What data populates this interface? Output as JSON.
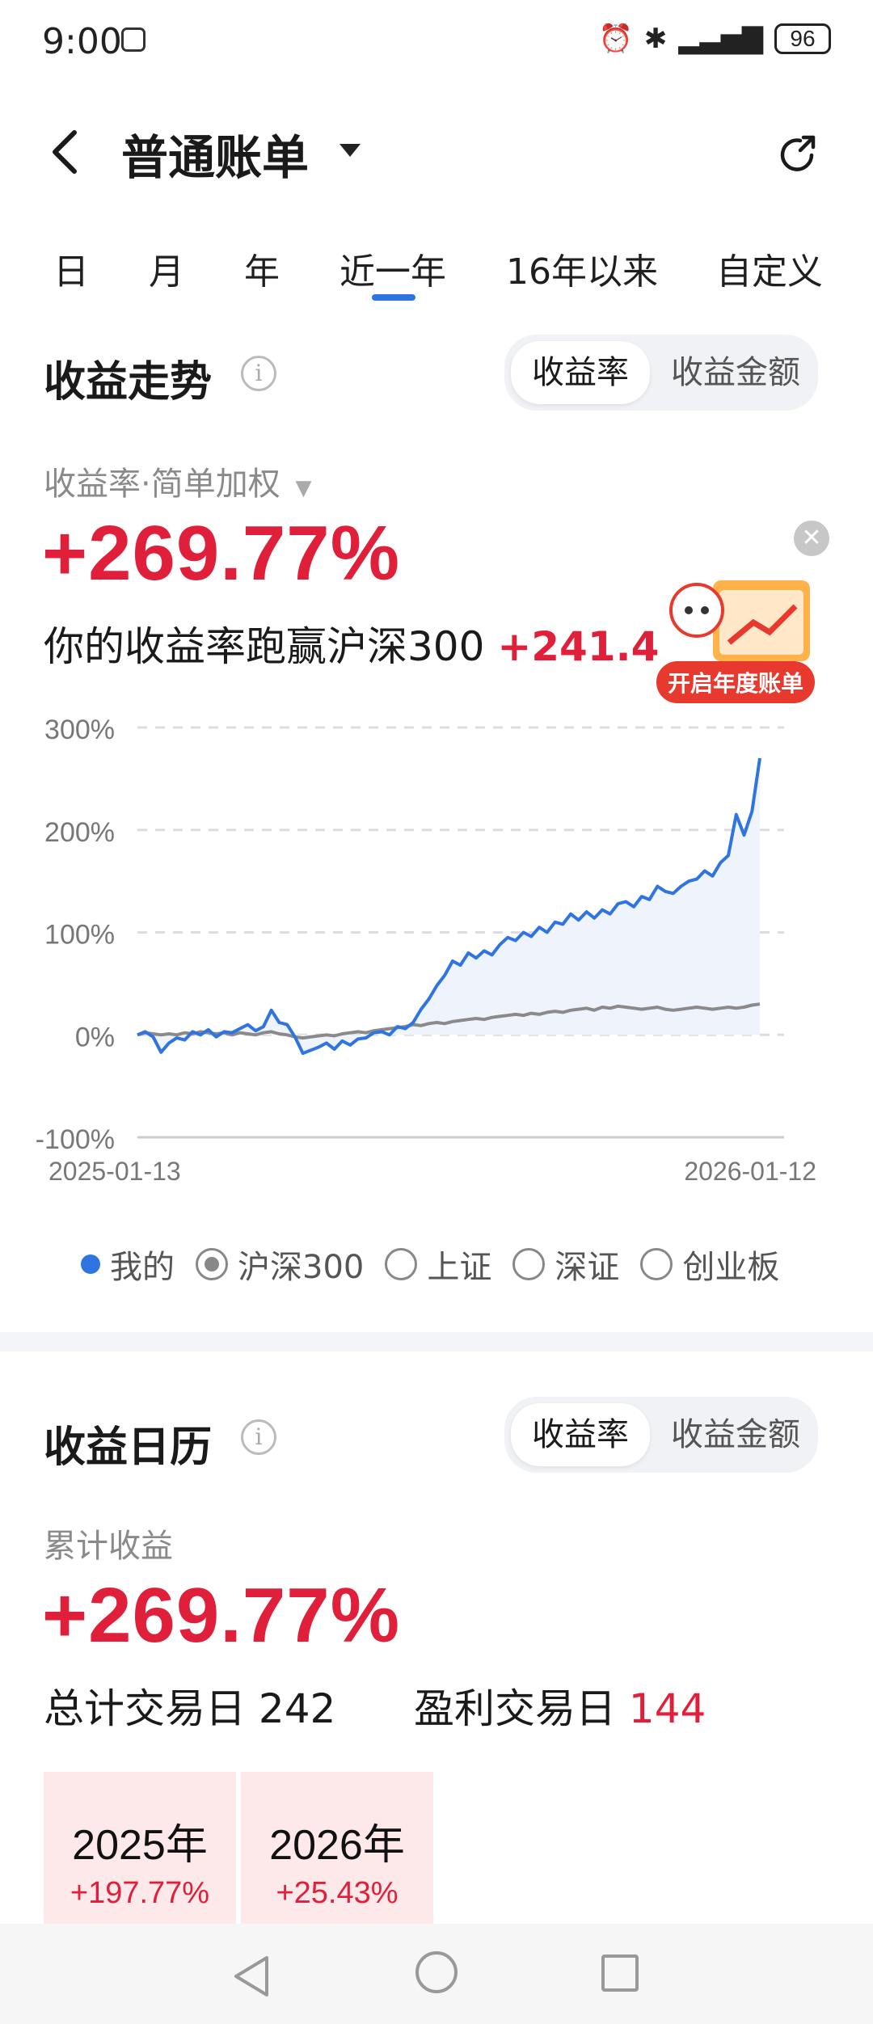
{
  "status_bar": {
    "time": "9:00",
    "battery": "96"
  },
  "header": {
    "title": "普通账单"
  },
  "tabs": [
    {
      "label": "日"
    },
    {
      "label": "月"
    },
    {
      "label": "年"
    },
    {
      "label": "近一年"
    },
    {
      "label": "16年以来"
    },
    {
      "label": "自定义"
    }
  ],
  "active_tab": "近一年",
  "trend": {
    "title": "收益走势",
    "toggle": {
      "active": "收益率",
      "inactive": "收益金额"
    },
    "metric_label": "收益率·简单加权",
    "return_value": "+269.77%",
    "beat_text": "你的收益率跑赢沪深300",
    "beat_value": "+241.4",
    "promo_button": "开启年度账单"
  },
  "chart_data": {
    "type": "line",
    "yticks": [
      "300%",
      "200%",
      "100%",
      "0%",
      "-100%"
    ],
    "ylim": [
      -100,
      300
    ],
    "x_start_label": "2025-01-13",
    "x_end_label": "2026-01-12",
    "series": [
      {
        "name": "我的",
        "color": "#2f74e0",
        "values": [
          0,
          3,
          -2,
          -17,
          -8,
          -3,
          -5,
          3,
          0,
          5,
          -2,
          3,
          2,
          6,
          10,
          4,
          8,
          24,
          12,
          10,
          -2,
          -18,
          -15,
          -12,
          -8,
          -14,
          -6,
          -10,
          -4,
          -3,
          2,
          3,
          0,
          8,
          6,
          12,
          25,
          35,
          48,
          58,
          72,
          68,
          80,
          75,
          82,
          78,
          88,
          95,
          92,
          100,
          96,
          105,
          100,
          110,
          108,
          118,
          112,
          120,
          114,
          122,
          118,
          128,
          130,
          125,
          135,
          132,
          145,
          140,
          138,
          145,
          150,
          152,
          160,
          155,
          168,
          175,
          215,
          195,
          218,
          270
        ]
      },
      {
        "name": "沪深300",
        "color": "#8a8a8a",
        "values": [
          0,
          2,
          1,
          0,
          1,
          0,
          2,
          1,
          3,
          2,
          1,
          2,
          0,
          2,
          1,
          0,
          2,
          3,
          1,
          0,
          -2,
          -3,
          -2,
          -1,
          0,
          -1,
          1,
          2,
          3,
          2,
          4,
          5,
          6,
          7,
          8,
          10,
          9,
          11,
          12,
          11,
          13,
          14,
          15,
          16,
          15,
          17,
          18,
          19,
          20,
          19,
          21,
          20,
          22,
          23,
          22,
          24,
          25,
          26,
          24,
          27,
          26,
          28,
          27,
          26,
          25,
          26,
          27,
          25,
          24,
          25,
          26,
          27,
          26,
          25,
          26,
          27,
          26,
          27,
          29,
          30
        ]
      }
    ]
  },
  "legend": [
    {
      "label": "我的",
      "type": "dot"
    },
    {
      "label": "沪深300",
      "type": "radio-on"
    },
    {
      "label": "上证",
      "type": "radio"
    },
    {
      "label": "深证",
      "type": "radio"
    },
    {
      "label": "创业板",
      "type": "radio"
    }
  ],
  "calendar": {
    "title": "收益日历",
    "toggle": {
      "active": "收益率",
      "inactive": "收益金额"
    },
    "cumulative_label": "累计收益",
    "cumulative_value": "+269.77%",
    "trade_days_label": "总计交易日",
    "trade_days": "242",
    "profit_days_label": "盈利交易日",
    "profit_days": "144",
    "years": [
      {
        "year": "2025年",
        "value": "+197.77%"
      },
      {
        "year": "2026年",
        "value": "+25.43%"
      }
    ]
  }
}
